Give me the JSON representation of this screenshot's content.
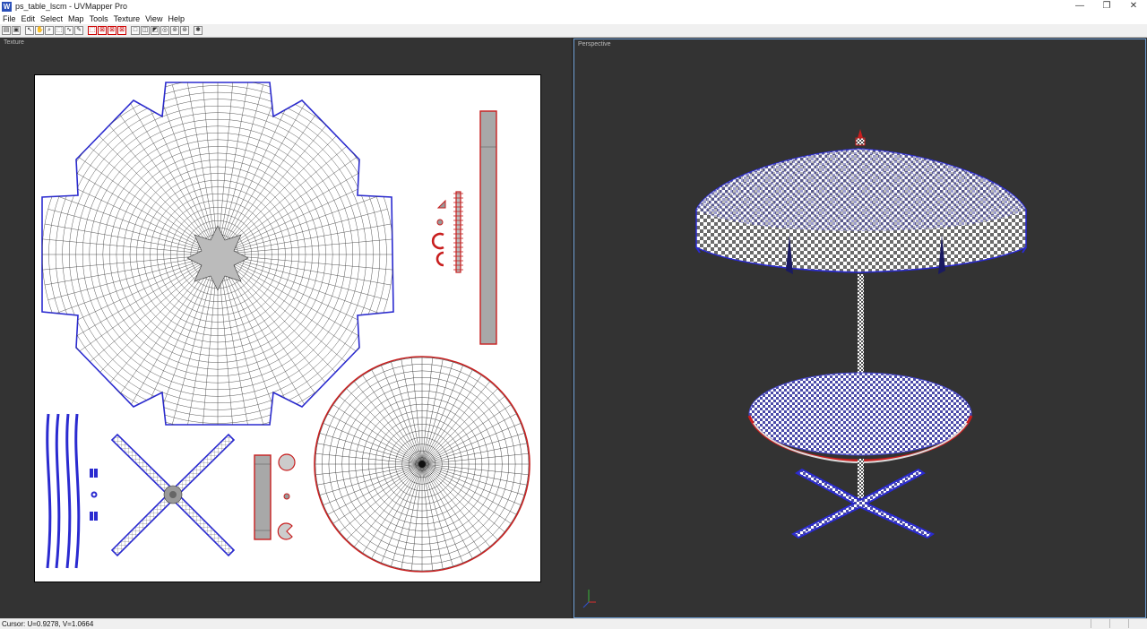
{
  "window": {
    "title": "ps_table_lscm - UVMapper Pro",
    "icon_letter": "W"
  },
  "window_buttons": {
    "minimize": "—",
    "restore": "❐",
    "close": "✕"
  },
  "menu": [
    "File",
    "Edit",
    "Select",
    "Map",
    "Tools",
    "Texture",
    "View",
    "Help"
  ],
  "toolbar": [
    {
      "icon": "open-icon",
      "glyph": "▤"
    },
    {
      "icon": "save-icon",
      "glyph": "▣"
    },
    {
      "icon": "pointer-icon",
      "glyph": "↖"
    },
    {
      "icon": "hand-icon",
      "glyph": "✋"
    },
    {
      "icon": "zoom-icon",
      "glyph": "⌕"
    },
    {
      "icon": "marquee-icon",
      "glyph": "⬚"
    },
    {
      "icon": "lasso-icon",
      "glyph": "∿"
    },
    {
      "icon": "paint-icon",
      "glyph": "✎"
    },
    {
      "icon": "select-box-icon",
      "glyph": "⬚"
    },
    {
      "icon": "deselect-icon",
      "glyph": "⊠"
    },
    {
      "icon": "invert-icon",
      "glyph": "⊠"
    },
    {
      "icon": "delete-icon",
      "glyph": "⊠"
    },
    {
      "icon": "vertex-icon",
      "glyph": "□"
    },
    {
      "icon": "edge-icon",
      "glyph": "◫"
    },
    {
      "icon": "face-icon",
      "glyph": "◩"
    },
    {
      "icon": "group-icon",
      "glyph": "◎"
    },
    {
      "icon": "material-icon",
      "glyph": "⊚"
    },
    {
      "icon": "region-icon",
      "glyph": "⊛"
    },
    {
      "icon": "settings-icon",
      "glyph": "✱"
    }
  ],
  "panes": {
    "left_label": "Texture",
    "right_label": "Perspective"
  },
  "status": {
    "cursor": "Cursor: U=0.9278, V=1.0664"
  },
  "colors": {
    "background": "#333333",
    "uv_blue": "#2a2ad0",
    "uv_red": "#c81e1e",
    "mesh": "#333333",
    "viewport_border": "#6a9ad0"
  }
}
